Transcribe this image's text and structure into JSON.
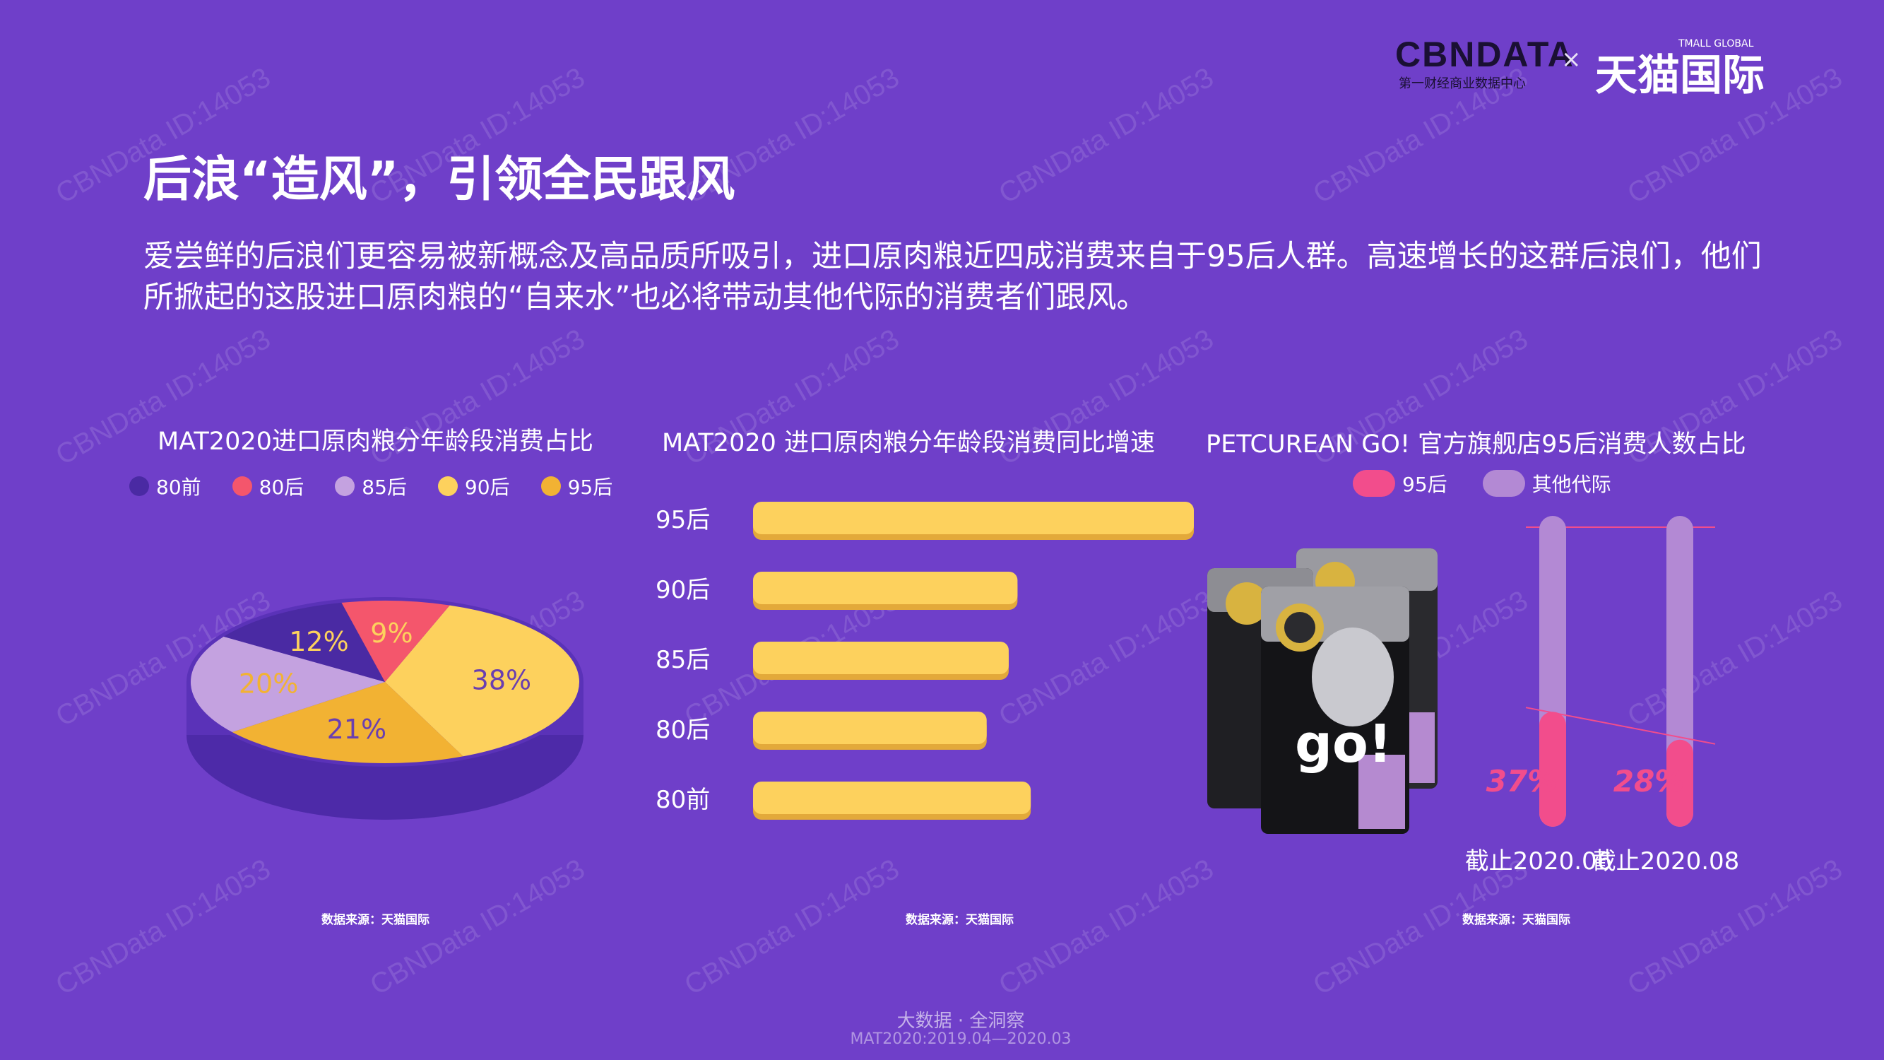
{
  "header": {
    "logo_cbn": "CBNDATA",
    "logo_cbn_sub": "第一财经商业数据中心",
    "logo_separator": "×",
    "logo_tmall": "天猫国际",
    "logo_tmall_en": "TMALL GLOBAL"
  },
  "title": "后浪“造风”，引领全民跟风",
  "intro": "爱尝鲜的后浪们更容易被新概念及高品质所吸引，进口原肉粮近四成消费来自于95后人群。高速增长的这群后浪们，他们所掀起的这股进口原肉粮的“自来水”也必将带动其他代际的消费者们跟风。",
  "watermark": "CBNData ID:14053",
  "footer": {
    "line1": "大数据 · 全洞察",
    "line2": "MAT2020:2019.04—2020.03"
  },
  "colors": {
    "bg": "#6f3fc9",
    "yellow": "#fdd15d",
    "orange": "#f2b233",
    "pink": "#f24d8c",
    "lavender": "#b389d4"
  },
  "product_image": {
    "brand_text": "go!"
  },
  "chart_data": [
    {
      "type": "pie",
      "title": "MAT2020进口原肉粮分年龄段消费占比",
      "legend": [
        {
          "name": "80前",
          "color": "#4a2aa3"
        },
        {
          "name": "80后",
          "color": "#f4566c"
        },
        {
          "name": "85后",
          "color": "#c4a2e0"
        },
        {
          "name": "90后",
          "color": "#fdd15d"
        },
        {
          "name": "95后",
          "color": "#f2b233"
        }
      ],
      "slices": [
        {
          "label": "38%",
          "value": 38,
          "color": "#fdd15d",
          "text_color": "#6a3fb0"
        },
        {
          "label": "21%",
          "value": 21,
          "color": "#f2b233",
          "text_color": "#6a3fb0"
        },
        {
          "label": "20%",
          "value": 20,
          "color": "#c4a2e0",
          "text_color": "#f2b233"
        },
        {
          "label": "12%",
          "value": 12,
          "color": "#4a2aa3",
          "text_color": "#fdd15d"
        },
        {
          "label": "9%",
          "value": 9,
          "color": "#f4566c",
          "text_color": "#fdd15d"
        }
      ],
      "source": "数据来源：天猫国际"
    },
    {
      "type": "bar",
      "orientation": "horizontal",
      "title": "MAT2020 进口原肉粮分年龄段消费同比增速",
      "categories": [
        "95后",
        "90后",
        "85后",
        "80后",
        "80前"
      ],
      "values": [
        100,
        60,
        58,
        53,
        63
      ],
      "xlim": [
        0,
        100
      ],
      "color": "#fdd15d",
      "source": "数据来源：天猫国际"
    },
    {
      "type": "bar",
      "title": "PETCUREAN GO! 官方旗舰店95后消费人数占比",
      "legend": [
        {
          "name": "95后",
          "color": "#f24d8c"
        },
        {
          "name": "其他代际",
          "color": "#b389d4"
        }
      ],
      "categories": [
        "截止2020.06",
        "截止2020.08"
      ],
      "series": [
        {
          "name": "95后",
          "values": [
            37,
            28
          ]
        },
        {
          "name": "其他代际",
          "values": [
            63,
            72
          ]
        }
      ],
      "data_labels": [
        "37%",
        "28%"
      ],
      "ylim": [
        0,
        100
      ],
      "source": "数据来源：天猫国际"
    }
  ]
}
